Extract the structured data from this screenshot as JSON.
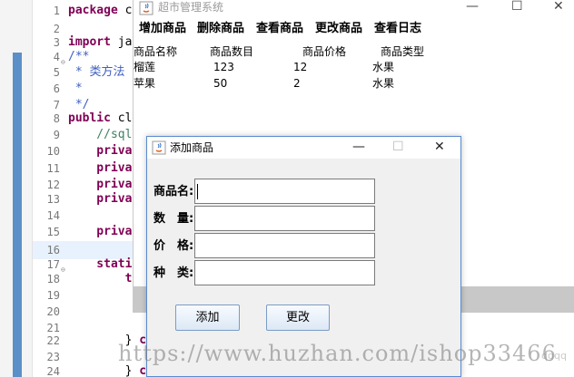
{
  "ide": {
    "lines": [
      {
        "num": "1",
        "fold": "",
        "parts": [
          {
            "c": "kw",
            "t": "package"
          },
          {
            "c": "pl",
            "t": " c"
          }
        ]
      },
      {
        "num": "2",
        "fold": "",
        "parts": []
      },
      {
        "num": "3",
        "fold": "",
        "parts": [
          {
            "c": "kw",
            "t": "import"
          },
          {
            "c": "pl",
            "t": " ja"
          }
        ]
      },
      {
        "num": "4",
        "fold": "⊖",
        "parts": [
          {
            "c": "jd",
            "t": "/**"
          }
        ]
      },
      {
        "num": "5",
        "fold": "",
        "parts": [
          {
            "c": "jd",
            "t": " * 类方法"
          }
        ]
      },
      {
        "num": "6",
        "fold": "",
        "parts": [
          {
            "c": "jd",
            "t": " *"
          }
        ]
      },
      {
        "num": "7",
        "fold": "",
        "parts": [
          {
            "c": "jd",
            "t": " */"
          }
        ]
      },
      {
        "num": "8",
        "fold": "",
        "parts": [
          {
            "c": "kw",
            "t": "public"
          },
          {
            "c": "pl",
            "t": " cl"
          }
        ]
      },
      {
        "num": "9",
        "fold": "",
        "parts": [
          {
            "c": "cm",
            "t": "    //sql"
          }
        ]
      },
      {
        "num": "10",
        "fold": "",
        "parts": [
          {
            "c": "kw",
            "t": "    priva"
          }
        ]
      },
      {
        "num": "11",
        "fold": "",
        "parts": [
          {
            "c": "kw",
            "t": "    priva"
          }
        ]
      },
      {
        "num": "12",
        "fold": "",
        "parts": [
          {
            "c": "kw",
            "t": "    priva"
          }
        ]
      },
      {
        "num": "13",
        "fold": "",
        "parts": [
          {
            "c": "kw",
            "t": "    priva"
          }
        ]
      },
      {
        "num": "14",
        "fold": "",
        "parts": []
      },
      {
        "num": "15",
        "fold": "",
        "parts": [
          {
            "c": "kw",
            "t": "    priva"
          }
        ]
      },
      {
        "num": "16",
        "fold": "",
        "parts": []
      },
      {
        "num": "17",
        "fold": "⊖",
        "parts": [
          {
            "c": "kw",
            "t": "    stati"
          }
        ]
      },
      {
        "num": "18",
        "fold": "",
        "parts": [
          {
            "c": "kw",
            "t": "        t"
          }
        ]
      },
      {
        "num": "19",
        "fold": "",
        "parts": []
      },
      {
        "num": "20",
        "fold": "",
        "parts": []
      },
      {
        "num": "21",
        "fold": "",
        "parts": []
      },
      {
        "num": "22",
        "fold": "",
        "parts": [
          {
            "c": "pl",
            "t": "        } "
          },
          {
            "c": "kw",
            "t": "c"
          }
        ]
      },
      {
        "num": "23",
        "fold": "",
        "parts": []
      },
      {
        "num": "24",
        "fold": "",
        "parts": [
          {
            "c": "pl",
            "t": "        } "
          },
          {
            "c": "kw",
            "t": "c"
          }
        ]
      }
    ]
  },
  "main_window": {
    "title": "超市管理系统",
    "menu": [
      "增加商品",
      "删除商品",
      "查看商品",
      "更改商品",
      "查看日志"
    ],
    "columns": [
      "商品名称",
      "商品数目",
      "商品价格",
      "商品类型"
    ],
    "rows": [
      [
        "榴莲",
        "123",
        "12",
        "水果"
      ],
      [
        "苹果",
        "50",
        "2",
        "水果"
      ]
    ],
    "controls": {
      "minimize": "—",
      "maximize": "☐",
      "close": "✕"
    }
  },
  "dialog": {
    "title": "添加商品",
    "controls": {
      "minimize": "—",
      "maximize": "☐",
      "close": "✕"
    },
    "fields": [
      {
        "label": "商品名:",
        "value": ""
      },
      {
        "label": "数　量:",
        "value": ""
      },
      {
        "label": "价　格:",
        "value": ""
      },
      {
        "label": "种　类:",
        "value": ""
      }
    ],
    "buttons": {
      "add": "添加",
      "update": "更改"
    }
  },
  "watermark": {
    "text": "https://www.huzhan.com/ishop33466",
    "side": "qgqq"
  },
  "colors": {
    "dialog_border": "#5a8bd0",
    "button_border": "#7a9cc6",
    "keyword": "#7f0055",
    "comment": "#3f7f5f",
    "javadoc": "#3f5fbf"
  }
}
